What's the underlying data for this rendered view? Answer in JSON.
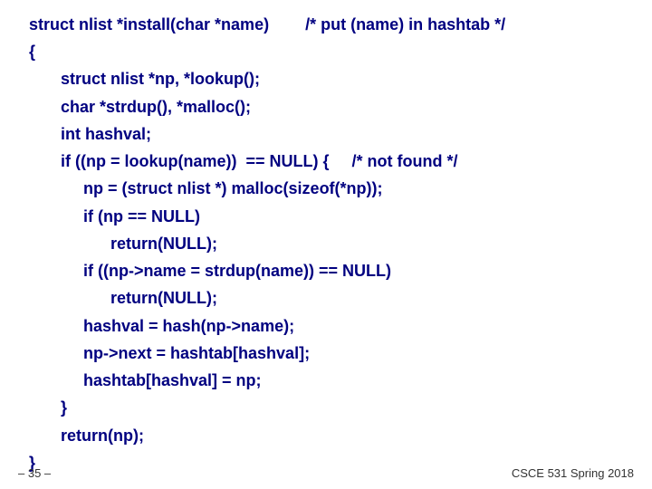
{
  "code": {
    "l1": "struct nlist *install(char *name)        /* put (name) in hashtab */",
    "l2": "{",
    "l3": "       struct nlist *np, *lookup();",
    "l4": "       char *strdup(), *malloc();",
    "l5": "       int hashval;",
    "l6": "       if ((np = lookup(name))  == NULL) {     /* not found */",
    "l7": "            np = (struct nlist *) malloc(sizeof(*np));",
    "l8": "            if (np == NULL)",
    "l9": "                  return(NULL);",
    "l10": "            if ((np->name = strdup(name)) == NULL)",
    "l11": "                  return(NULL);",
    "l12": "            hashval = hash(np->name);",
    "l13": "            np->next = hashtab[hashval];",
    "l14": "            hashtab[hashval] = np;",
    "l15": "       }",
    "l16": "       return(np);",
    "l17": "}"
  },
  "footer": {
    "left": "– 35 –",
    "right": "CSCE 531 Spring 2018"
  }
}
